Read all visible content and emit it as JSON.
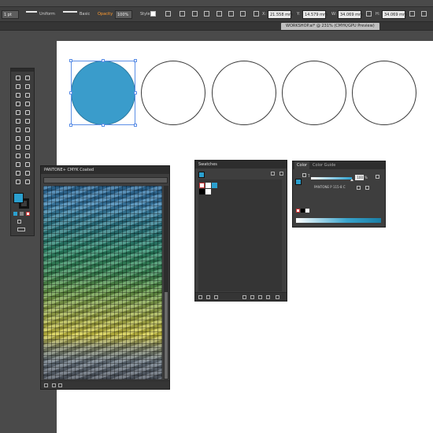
{
  "controlbar": {
    "stroke_weight": "1 pt",
    "stroke_profile": "Uniform",
    "brush_definition": "Basic",
    "opacity_label": "Opacity",
    "opacity_value": "100%",
    "style_label": "Style",
    "x_value": "21.558 mm",
    "y_value": "14.579 mm",
    "w_value": "34.069 mm",
    "h_value": "34.069 mm"
  },
  "document": {
    "tab_label": "WORKSHOP.ai* @ 231% (CMYK/GPU Preview)"
  },
  "panels": {
    "pantone_library": {
      "title": "PANTONE+ CMYK Coated"
    },
    "swatches": {
      "title": "Swatches"
    },
    "color": {
      "tab_color": "Color",
      "tab_guide": "Color Guide",
      "tint_label": "T",
      "tint_value": "100",
      "tint_unit": "%",
      "swatch_name": "PANTONE P 115-8 C"
    }
  },
  "colors": {
    "selected_fill": "#2ba0cf",
    "artboard": "#ffffff",
    "ui_background": "#4a4a4a",
    "selection": "#5b8ee6"
  },
  "artboard": {
    "circles": [
      {
        "fill": "#3a9ccb",
        "selected": true
      },
      {
        "fill": "none",
        "selected": false
      },
      {
        "fill": "none",
        "selected": false
      },
      {
        "fill": "none",
        "selected": false
      },
      {
        "fill": "none",
        "selected": false
      }
    ]
  }
}
